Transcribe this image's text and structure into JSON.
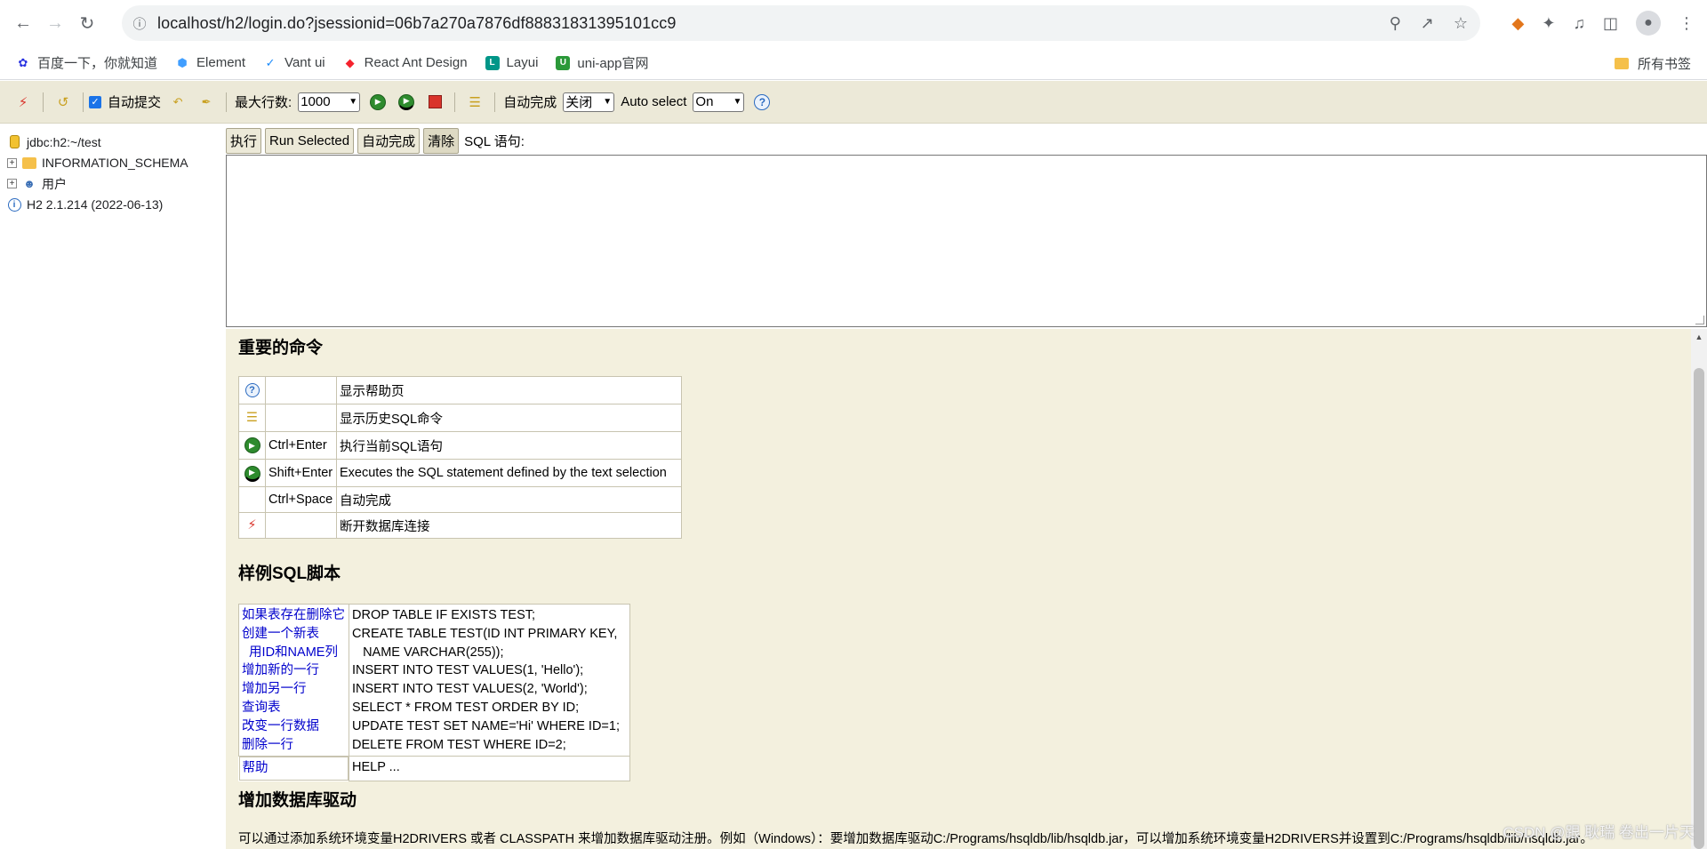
{
  "browser": {
    "url": "localhost/h2/login.do?jsessionid=06b7a270a7876df88831831395101cc9",
    "bookmarks": [
      {
        "label": "百度一下，你就知道",
        "icon": "baidu-icon",
        "color": "#2932e1"
      },
      {
        "label": "Element",
        "icon": "element-icon",
        "color": "#409eff"
      },
      {
        "label": "Vant ui",
        "icon": "vant-icon",
        "color": "#1989fa"
      },
      {
        "label": "React Ant Design",
        "icon": "antd-icon",
        "color": "#f5222d"
      },
      {
        "label": "Layui",
        "icon": "layui-icon",
        "color": "#009688"
      },
      {
        "label": "uni-app官网",
        "icon": "uniapp-icon",
        "color": "#2b9939"
      }
    ],
    "all_bookmarks": "所有书签"
  },
  "toolbar": {
    "auto_commit": "自动提交",
    "max_rows_label": "最大行数:",
    "max_rows_value": "1000",
    "autocomplete_label": "自动完成",
    "autocomplete_value": "关闭",
    "auto_select_label": "Auto select",
    "auto_select_value": "On"
  },
  "tree": {
    "connection": "jdbc:h2:~/test",
    "items": [
      "INFORMATION_SCHEMA",
      "用户"
    ],
    "version": "H2 2.1.214 (2022-06-13)"
  },
  "query": {
    "buttons": [
      "执行",
      "Run Selected",
      "自动完成",
      "清除"
    ],
    "label": "SQL 语句:"
  },
  "help": {
    "important_title": "重要的命令",
    "commands": [
      {
        "icon": "help-icon",
        "key": "",
        "desc": "显示帮助页"
      },
      {
        "icon": "history-icon",
        "key": "",
        "desc": "显示历史SQL命令"
      },
      {
        "icon": "run-icon",
        "key": "Ctrl+Enter",
        "desc": "执行当前SQL语句"
      },
      {
        "icon": "run-selected-icon",
        "key": "Shift+Enter",
        "desc": "Executes the SQL statement defined by the text selection"
      },
      {
        "icon": "",
        "key": "Ctrl+Space",
        "desc": "自动完成"
      },
      {
        "icon": "disconnect-icon",
        "key": "",
        "desc": "断开数据库连接"
      }
    ],
    "sample_title": "样例SQL脚本",
    "sample_links": [
      "如果表存在删除它",
      "创建一个新表",
      "  用ID和NAME列",
      "增加新的一行",
      "增加另一行",
      "查询表",
      "改变一行数据",
      "删除一行"
    ],
    "sample_code": [
      "DROP TABLE IF EXISTS TEST;",
      "CREATE TABLE TEST(ID INT PRIMARY KEY,",
      "   NAME VARCHAR(255));",
      "INSERT INTO TEST VALUES(1, 'Hello');",
      "INSERT INTO TEST VALUES(2, 'World');",
      "SELECT * FROM TEST ORDER BY ID;",
      "UPDATE TEST SET NAME='Hi' WHERE ID=1;",
      "DELETE FROM TEST WHERE ID=2;"
    ],
    "help_link": "帮助",
    "help_code": "HELP ...",
    "drivers_title": "增加数据库驱动",
    "drivers_text": "可以通过添加系统环境变量H2DRIVERS 或者 CLASSPATH 来增加数据库驱动注册。例如（Windows）：要增加数据库驱动C:/Programs/hsqldb/lib/hsqldb.jar，可以增加系统环境变量H2DRIVERS并设置到C:/Programs/hsqldb/lib/hsqldb.jar。"
  },
  "watermark": "CSDN @跟 耿瑞 卷出一片天"
}
